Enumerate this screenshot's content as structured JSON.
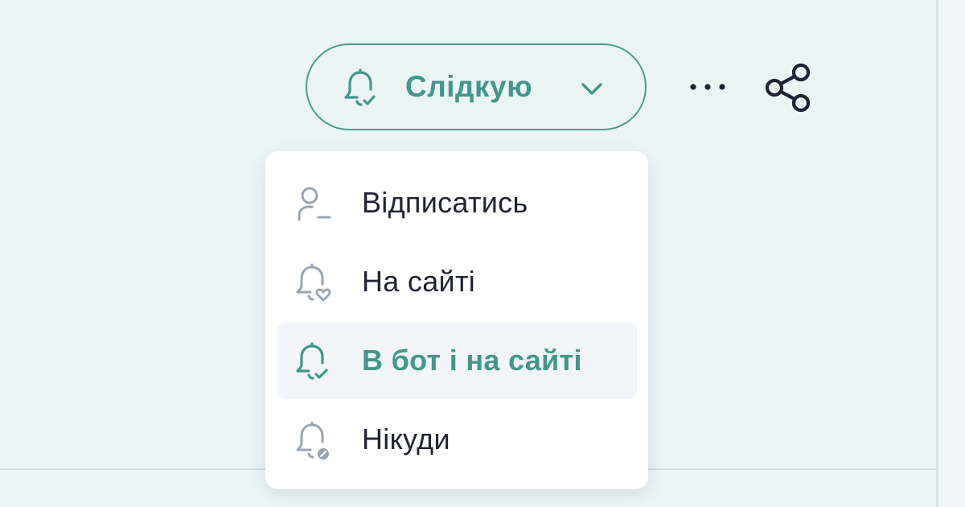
{
  "colors": {
    "accent": "#43968b",
    "text": "#1f2233",
    "icon_muted": "#9aa3b2",
    "selected_bg": "#f1f4f8",
    "background": "#eaf4f5"
  },
  "follow_button": {
    "label": "Слідкую",
    "icon": "bell-check-icon",
    "dropdown_icon": "chevron-down-icon"
  },
  "actions": {
    "more_icon": "more-horizontal-icon",
    "share_icon": "share-icon"
  },
  "menu": {
    "items": [
      {
        "label": "Відписатись",
        "icon": "user-minus-icon",
        "selected": false
      },
      {
        "label": "На сайті",
        "icon": "bell-heart-icon",
        "selected": false
      },
      {
        "label": "В бот і на сайті",
        "icon": "bell-check-icon",
        "selected": true
      },
      {
        "label": "Нікуди",
        "icon": "bell-off-icon",
        "selected": false
      }
    ]
  }
}
